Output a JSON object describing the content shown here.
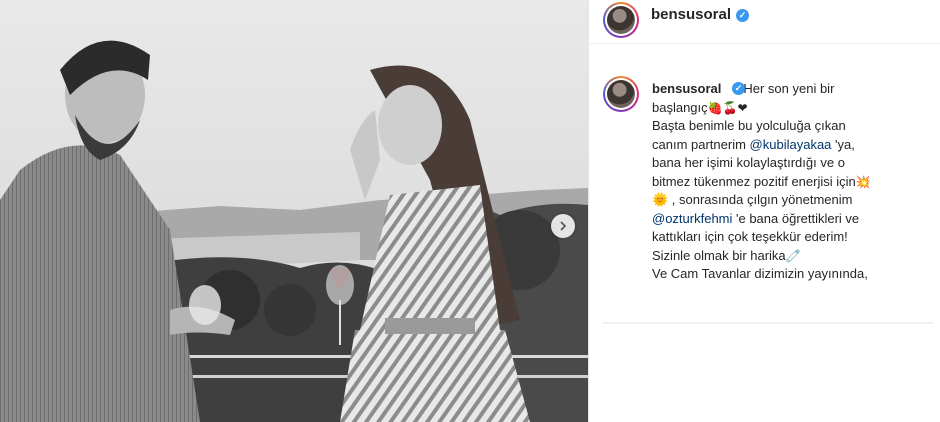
{
  "header": {
    "username": "bensusoral"
  },
  "caption": {
    "username": "bensusoral",
    "lines": [
      {
        "pre": "Her son yeni bir",
        "mention": "",
        "post": ""
      },
      {
        "pre": "başlangıç",
        "mention": "",
        "post": "🍓🍒❤"
      },
      {
        "pre": "Başta benimle bu yolculuğa çıkan",
        "mention": "",
        "post": ""
      },
      {
        "pre": "canım partnerim ",
        "mention": "@kubilayakaa",
        "post": " 'ya,"
      },
      {
        "pre": "bana her işimi kolaylaştırdığı ve o",
        "mention": "",
        "post": ""
      },
      {
        "pre": "bitmez tükenmez pozitif enerjisi için",
        "mention": "",
        "post": "💥"
      },
      {
        "pre": "🌞 , sonrasında çılgın yönetmenim",
        "mention": "",
        "post": ""
      },
      {
        "pre": "",
        "mention": "@ozturkfehmi",
        "post": " 'e bana öğrettikleri ve"
      },
      {
        "pre": "kattıkları için çok teşekkür ederim!",
        "mention": "",
        "post": ""
      },
      {
        "pre": "Sizinle olmak bir harika",
        "mention": "",
        "post": "🧷"
      },
      {
        "pre": "Ve Cam Tavanlar dizimizin yayınında,",
        "mention": "",
        "post": ""
      }
    ]
  },
  "icons": {
    "verified": "verified-badge-icon",
    "next": "chevron-right-icon"
  },
  "colors": {
    "verified": "#3897f0",
    "mention": "#00376b",
    "text": "#262626"
  }
}
